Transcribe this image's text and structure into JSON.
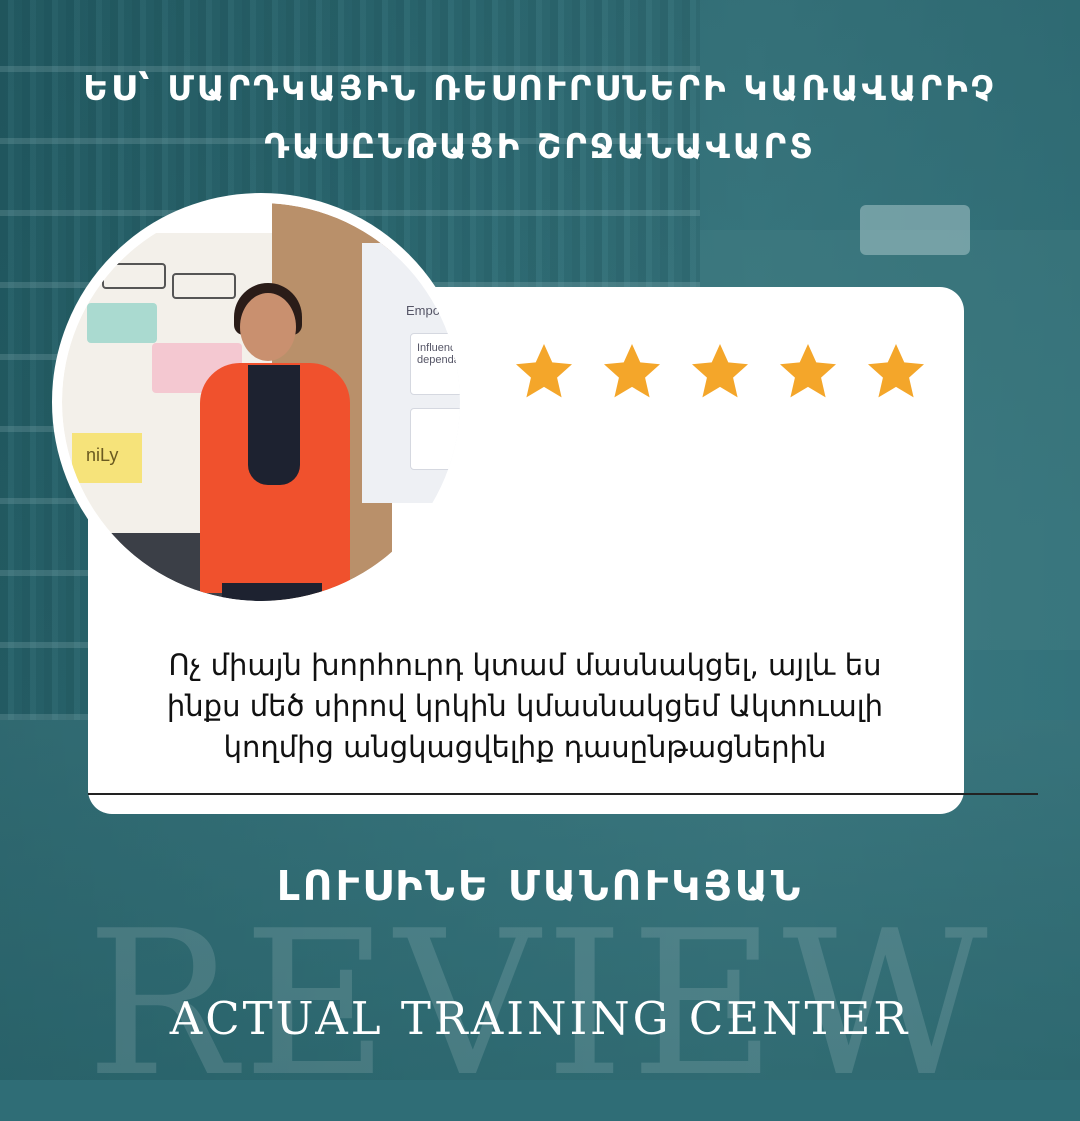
{
  "header": {
    "title_line1": "ԵՍ՝ ՄԱՐԴԿԱՅԻՆ ՌԵՍՈՒՐՍՆԵՐԻ ԿԱՌԱՎԱՐԻՉ",
    "title_line2": "ԴԱՍԸՆԹԱՑԻ ՇՐՋԱՆԱՎԱՐՏ"
  },
  "review": {
    "rating": 5,
    "rating_max": 5,
    "star_color": "#f4a62a",
    "quote_line1": "Ոչ միայն խորհուրդ կտամ մասնակցել, այլև ես",
    "quote_line2": "ինքս մեծ սիրով կրկին կմասնակցեմ Ակտուալի",
    "quote_line3": "կողմից անցկացվելիք դասընթացներին"
  },
  "photo": {
    "board_note_text": "niLy",
    "screen_title": "Empow",
    "screen_box_text": "Influence dependab"
  },
  "author": {
    "name": "ԼՈՒՍԻՆԵ ՄԱՆՈՒԿՅԱՆ"
  },
  "footer": {
    "watermark": "REVIEW",
    "brand": "ACTUAL TRAINING CENTER"
  },
  "colors": {
    "background": "#2f6d76",
    "card": "#ffffff",
    "text_light": "#ffffff"
  }
}
